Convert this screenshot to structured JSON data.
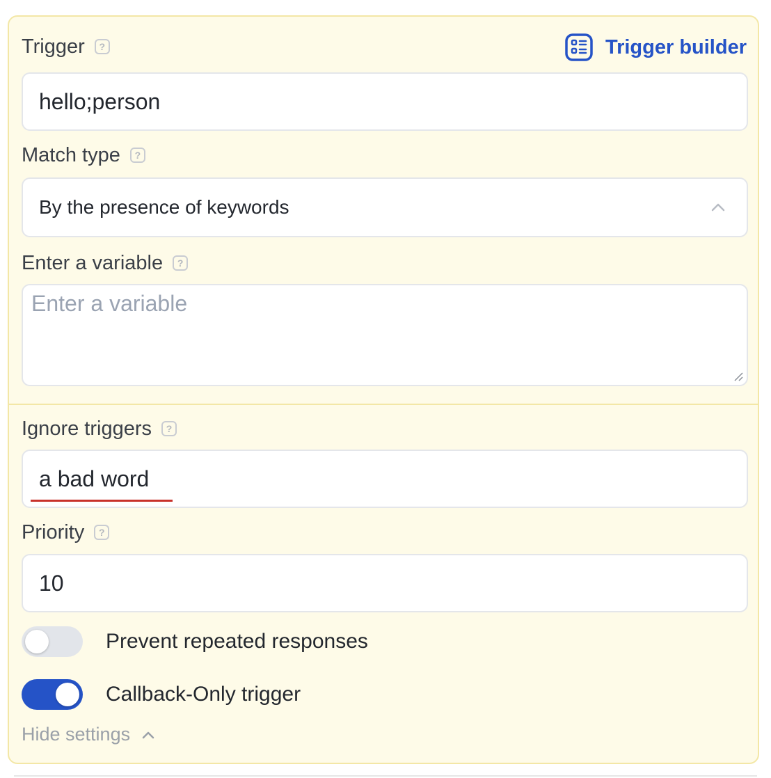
{
  "trigger": {
    "label": "Trigger",
    "help_icon": "question-icon",
    "builder_label": "Trigger builder",
    "builder_icon": "list-builder-icon",
    "value": "hello;person"
  },
  "match_type": {
    "label": "Match type",
    "selected": "By the presence of keywords",
    "chevron_icon": "chevron-up-icon"
  },
  "variable": {
    "label": "Enter a variable",
    "placeholder": "Enter a variable",
    "value": ""
  },
  "ignore_triggers": {
    "label": "Ignore triggers",
    "value": "a bad word"
  },
  "priority": {
    "label": "Priority",
    "value": "10"
  },
  "toggles": [
    {
      "label": "Prevent repeated responses",
      "on": false
    },
    {
      "label": "Callback-Only trigger",
      "on": true
    }
  ],
  "hide_settings": {
    "label": "Hide settings",
    "icon": "chevron-up-icon"
  },
  "colors": {
    "accent": "#2553c7",
    "panel_bg": "#fefbe8",
    "panel_border": "#f3e7a6",
    "spellcheck": "#c8322b"
  }
}
